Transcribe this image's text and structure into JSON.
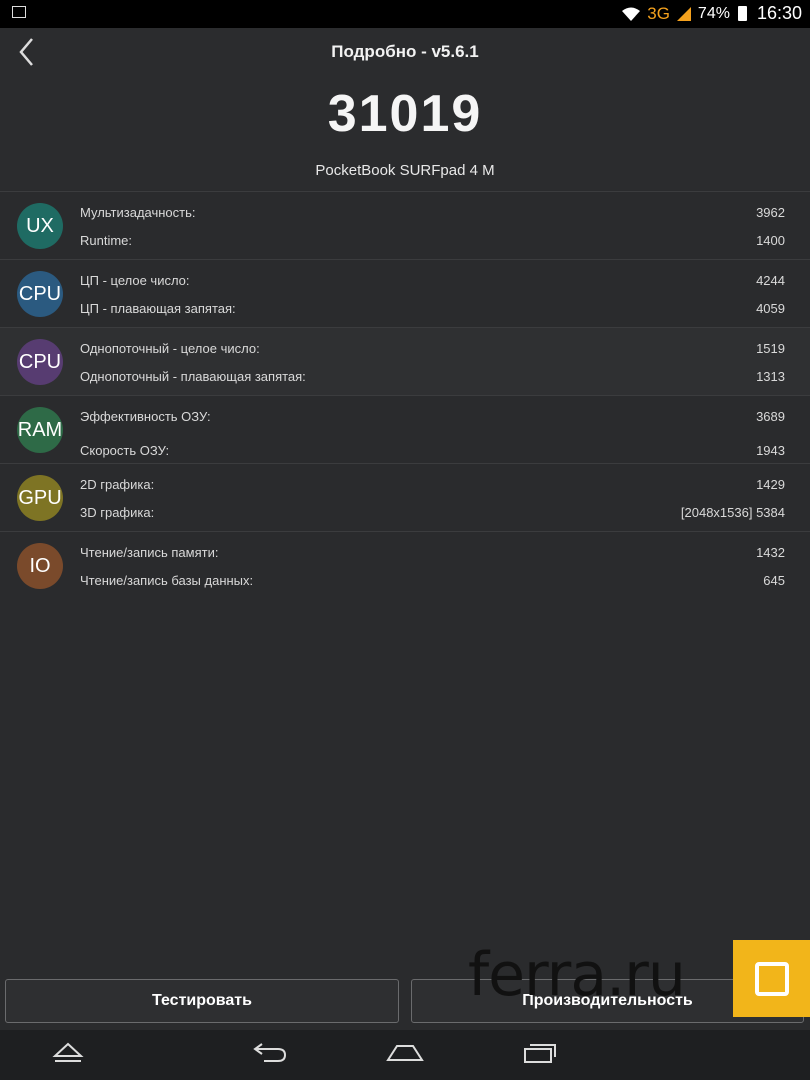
{
  "status": {
    "network": "3G",
    "battery": "74%",
    "time": "16:30"
  },
  "header": {
    "title": "Подробно - v5.6.1",
    "score": "31019",
    "device": "PocketBook SURFpad 4 M"
  },
  "categories": [
    {
      "badge": "UX",
      "color": "#1f6b63",
      "items": [
        {
          "label": "Мультизадачность:",
          "value": "3962"
        },
        {
          "label": "Runtime:",
          "value": "1400"
        }
      ]
    },
    {
      "badge": "CPU",
      "color": "#2b5a80",
      "items": [
        {
          "label": "ЦП - целое число:",
          "value": "4244"
        },
        {
          "label": "ЦП - плавающая запятая:",
          "value": "4059"
        }
      ]
    },
    {
      "badge": "CPU",
      "color": "#573c71",
      "items": [
        {
          "label": "Однопоточный - целое число:",
          "value": "1519"
        },
        {
          "label": "Однопоточный - плавающая запятая:",
          "value": "1313"
        }
      ]
    },
    {
      "badge": "RAM",
      "color": "#2e6a47",
      "items": [
        {
          "label": "Эффективность ОЗУ:",
          "value": "3689"
        },
        {
          "label": "Скорость ОЗУ:",
          "value": "1943"
        }
      ]
    },
    {
      "badge": "GPU",
      "color": "#7e7424",
      "items": [
        {
          "label": "2D графика:",
          "value": "1429"
        },
        {
          "label": "3D графика:",
          "value": "[2048x1536] 5384"
        }
      ]
    },
    {
      "badge": "IO",
      "color": "#7a4a2b",
      "items": [
        {
          "label": "Чтение/запись памяти:",
          "value": "1432"
        },
        {
          "label": "Чтение/запись базы данных:",
          "value": "645"
        }
      ]
    }
  ],
  "buttons": {
    "test": "Тестировать",
    "performance": "Производительность"
  },
  "watermark": "ferra.ru"
}
